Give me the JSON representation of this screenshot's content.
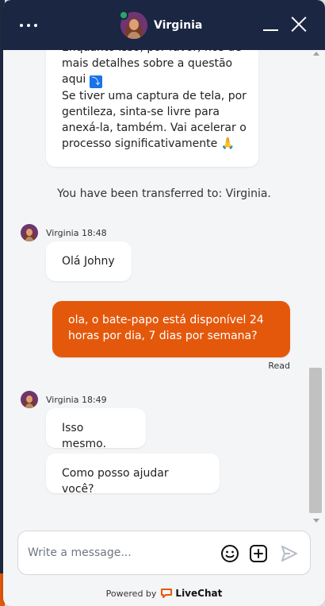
{
  "header": {
    "agent_name": "Virginia",
    "menu_icon": "more-horizontal-icon",
    "minimize_icon": "minimize-icon",
    "close_icon": "close-icon"
  },
  "messages": {
    "previous_bubble_lines": "Enquanto isso, por favor, nos dê\nmais detalhes sobre a questão\naqui ",
    "previous_bubble_emoji": "⤵",
    "previous_bubble_rest": "\nSe tiver uma captura de tela, por\ngentileza, sinta-se livre para\nanexá-la, também. Vai acelerar o\nprocesso significativamente 🙏",
    "system_message": "You have been transferred to: Virginia.",
    "group1_meta": "Virginia 18:48",
    "group1_msg1": "Olá Johny",
    "visitor_msg": "ola, o bate-papo está disponível 24\nhoras por dia, 7 dias por semana?",
    "visitor_status": "Read",
    "group2_meta": "Virginia 18:49",
    "group2_msg1": "Isso mesmo.",
    "group2_msg2": "Como posso ajudar você?"
  },
  "composer": {
    "placeholder": "Write a message...",
    "emoji_icon": "smiley-icon",
    "attach_icon": "plus-square-icon",
    "send_icon": "send-icon"
  },
  "footer": {
    "powered_by": "Powered by",
    "brand": "LiveChat"
  },
  "colors": {
    "header_bg": "#1b2642",
    "visitor_bubble": "#e4580c",
    "online": "#29a46b",
    "brand_orange": "#e8590c"
  }
}
